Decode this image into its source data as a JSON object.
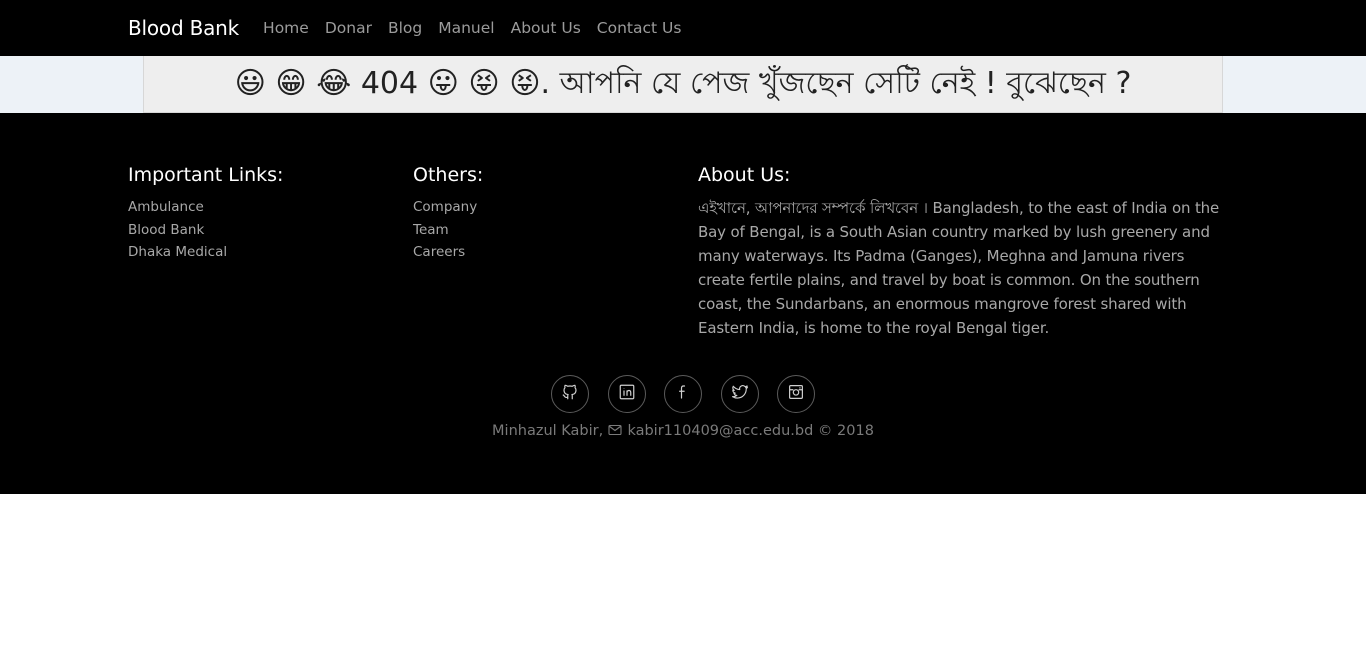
{
  "navbar": {
    "brand": "Blood Bank",
    "links": [
      "Home",
      "Donar",
      "Blog",
      "Manuel",
      "About Us",
      "Contact Us"
    ]
  },
  "banner": {
    "text": "😃 😁 😂 404 😛 😝 😝. আপনি যে পেজ খুঁজছেন সেটি নেই ! বুঝেছেন ?"
  },
  "footer": {
    "important_links": {
      "heading": "Important Links:",
      "items": [
        "Ambulance",
        "Blood Bank",
        "Dhaka Medical"
      ]
    },
    "others": {
      "heading": "Others:",
      "items": [
        "Company",
        "Team",
        "Careers"
      ]
    },
    "about": {
      "heading": "About Us:",
      "text": "এইখানে, আপনাদের সম্পর্কে লিখবেন । Bangladesh, to the east of India on the Bay of Bengal, is a South Asian country marked by lush greenery and many waterways. Its Padma (Ganges), Meghna and Jamuna rivers create fertile plains, and travel by boat is common. On the southern coast, the Sundarbans, an enormous mangrove forest shared with Eastern India, is home to the royal Bengal tiger."
    },
    "social_icons": [
      "github-icon",
      "linkedin-icon",
      "facebook-icon",
      "twitter-icon",
      "instagram-icon"
    ],
    "credit": {
      "name": "Minhazul Kabir,",
      "email": "kabir110409@acc.edu.bd",
      "copyright": "© 2018"
    }
  },
  "colors": {
    "navbar_bg": "#000000",
    "footer_bg": "#000000",
    "banner_bg": "#eeeeee",
    "strip_bg": "#edf2f7",
    "muted_text": "#a8a8a8"
  }
}
